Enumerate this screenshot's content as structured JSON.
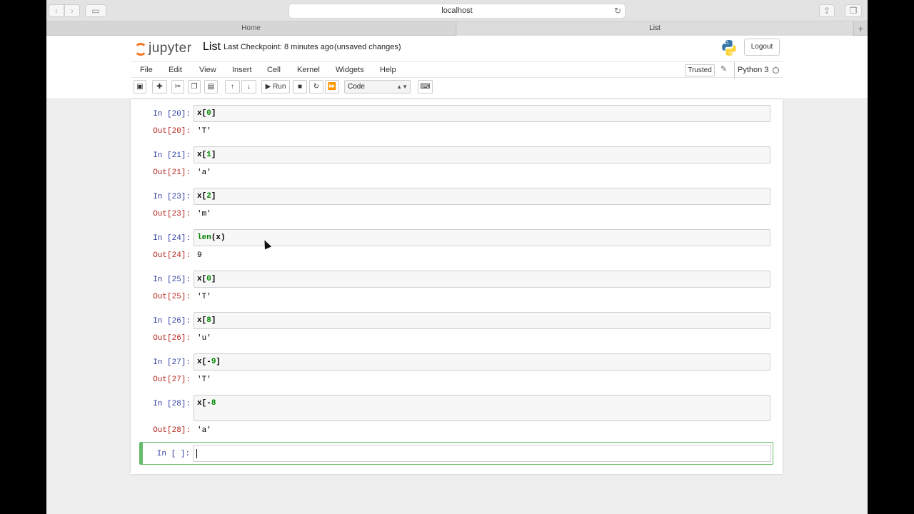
{
  "browser": {
    "address": "localhost",
    "tabs": [
      {
        "label": "Home"
      },
      {
        "label": "List"
      }
    ]
  },
  "jupyter": {
    "logo_text": "jupyter",
    "notebook_name": "List",
    "checkpoint": "Last Checkpoint: 8 minutes ago",
    "unsaved": "(unsaved changes)",
    "logout_label": "Logout",
    "menu": [
      "File",
      "Edit",
      "View",
      "Insert",
      "Cell",
      "Kernel",
      "Widgets",
      "Help"
    ],
    "trusted_label": "Trusted",
    "kernel_name": "Python 3",
    "toolbar": {
      "run_label": "Run",
      "cell_type": "Code"
    }
  },
  "cells": [
    {
      "in": "In [20]:",
      "code": "x[0]",
      "out": "Out[20]:",
      "value": "'T'"
    },
    {
      "in": "In [21]:",
      "code": "x[1]",
      "out": "Out[21]:",
      "value": "'a'"
    },
    {
      "in": "In [23]:",
      "code": "x[2]",
      "out": "Out[23]:",
      "value": "'m'"
    },
    {
      "in": "In [24]:",
      "code": "len(x)",
      "out": "Out[24]:",
      "value": "9"
    },
    {
      "in": "In [25]:",
      "code": "x[0]",
      "out": "Out[25]:",
      "value": "'T'"
    },
    {
      "in": "In [26]:",
      "code": "x[8]",
      "out": "Out[26]:",
      "value": "'u'"
    },
    {
      "in": "In [27]:",
      "code": "x[-9]",
      "out": "Out[27]:",
      "value": "'T'"
    },
    {
      "in": "In [28]:",
      "code": "x[-8",
      "out": "Out[28]:",
      "value": "'a'"
    }
  ],
  "active_cell": {
    "in": "In [ ]:",
    "code": ""
  }
}
